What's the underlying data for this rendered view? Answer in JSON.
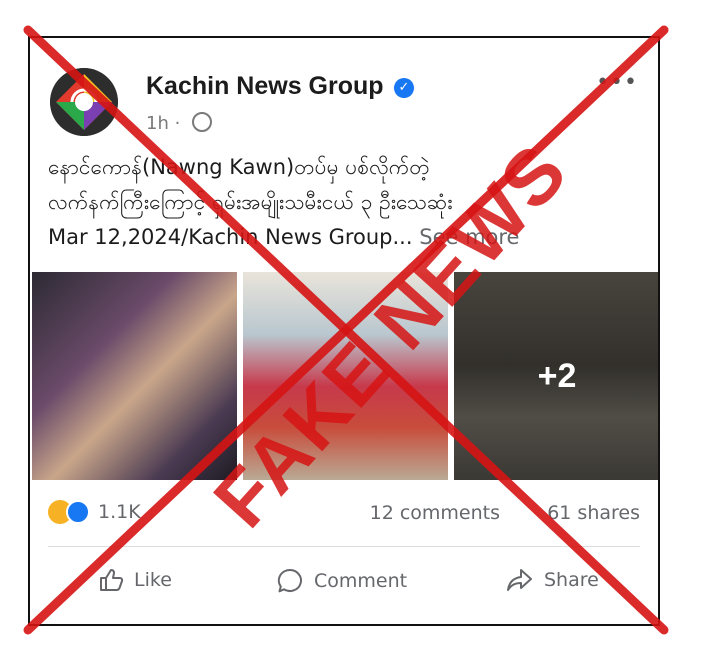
{
  "post": {
    "page_name": "Kachin News Group",
    "time": "1h",
    "more_label": "•••",
    "caption_line1": "နောင်ကောန်(Nawng Kawn)တပ်မှ ပစ်လိုက်တဲ့",
    "caption_line2": "လက်နက်ကြီးကြောင့် ရှမ်းအမျိုးသမီးငယ် ၃ ဦးသေဆုံး",
    "caption_line3": "Mar 12,2024/Kachin News Group...",
    "see_more": "See more",
    "more_photos": "+2",
    "reaction_count": "1.1K",
    "comments": "12 comments",
    "shares": "61 shares"
  },
  "actions": {
    "like": "Like",
    "comment": "Comment",
    "share": "Share"
  },
  "stamp": {
    "text": "FAKE NEWS",
    "color": "#d61414"
  },
  "colors": {
    "verified": "#1877f2",
    "muted_text": "#65676b"
  }
}
